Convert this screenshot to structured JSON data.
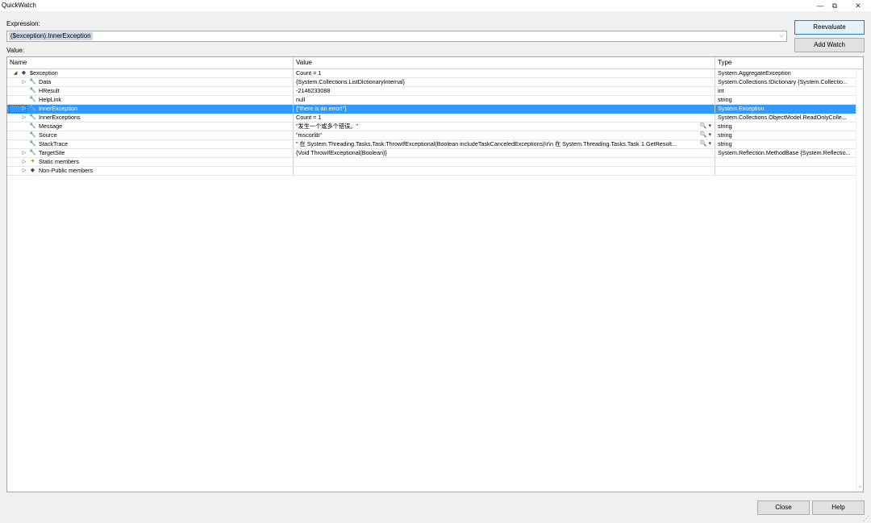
{
  "window": {
    "title": "QuickWatch",
    "minimize_glyph": "—",
    "restore_glyph": "⧉",
    "close_glyph": "✕"
  },
  "expression": {
    "label": "Expression:",
    "value": "($exception).InnerException"
  },
  "value_label": "Value:",
  "buttons": {
    "reevaluate": "Reevaluate",
    "add_watch": "Add Watch",
    "close": "Close",
    "help": "Help"
  },
  "grid": {
    "columns": [
      "Name",
      "Value",
      "Type"
    ],
    "rows": [
      {
        "name": "$exception",
        "value": "Count = 1",
        "type": "System.AggregateException",
        "icon": "object-icon",
        "expander": "expanded",
        "level": 0,
        "selected": false
      },
      {
        "name": "Data",
        "value": "{System.Collections.ListDictionaryInternal}",
        "type": "System.Collections.IDictionary {System.Collectio...",
        "icon": "wrench-icon",
        "expander": "collapsed",
        "level": 1,
        "selected": false
      },
      {
        "name": "HResult",
        "value": "-2146233088",
        "type": "int",
        "icon": "wrench-icon",
        "expander": "none",
        "level": 1,
        "selected": false
      },
      {
        "name": "HelpLink",
        "value": "null",
        "type": "string",
        "icon": "wrench-icon",
        "expander": "none",
        "level": 1,
        "selected": false
      },
      {
        "name": "InnerException",
        "value": "{\"there is an error!\"}",
        "type": "System.Exception",
        "icon": "wrench-icon",
        "expander": "collapsed",
        "level": 1,
        "selected": true
      },
      {
        "name": "InnerExceptions",
        "value": "Count = 1",
        "type": "System.Collections.ObjectModel.ReadOnlyColle...",
        "icon": "wrench-icon",
        "expander": "collapsed",
        "level": 1,
        "selected": false
      },
      {
        "name": "Message",
        "value": "\"发生一个或多个错误。\"",
        "type": "string",
        "icon": "wrench-icon",
        "expander": "none",
        "level": 1,
        "selected": false,
        "visualizer": true
      },
      {
        "name": "Source",
        "value": "\"mscorlib\"",
        "type": "string",
        "icon": "wrench-icon",
        "expander": "none",
        "level": 1,
        "selected": false,
        "visualizer": true
      },
      {
        "name": "StackTrace",
        "value": "\"   在 System.Threading.Tasks.Task.ThrowIfExceptional(Boolean includeTaskCanceledExceptions)\\r\\n   在 System.Threading.Tasks.Task`1.GetResult...",
        "type": "string",
        "icon": "wrench-icon",
        "expander": "none",
        "level": 1,
        "selected": false,
        "visualizer": true
      },
      {
        "name": "TargetSite",
        "value": "{Void ThrowIfExceptional(Boolean)}",
        "type": "System.Reflection.MethodBase {System.Reflectio...",
        "icon": "wrench-icon",
        "expander": "collapsed",
        "level": 1,
        "selected": false
      },
      {
        "name": "Static members",
        "value": "",
        "type": "",
        "icon": "static-members-icon",
        "expander": "collapsed",
        "level": 1,
        "selected": false
      },
      {
        "name": "Non-Public members",
        "value": "",
        "type": "",
        "icon": "object-icon",
        "expander": "collapsed",
        "level": 1,
        "selected": false
      }
    ]
  },
  "glyphs": {
    "expanded": "◢",
    "collapsed": "▷",
    "wrench": "🔧",
    "object": "◆",
    "static": "✦",
    "visualizer": "🔍 ▾",
    "dropdown": "⌵",
    "scroll_up": "▲",
    "scroll_down": "⌄",
    "grip": "⋰"
  },
  "colors": {
    "selection": "#3399ff",
    "accent_button_border": "#2f7bd1"
  }
}
